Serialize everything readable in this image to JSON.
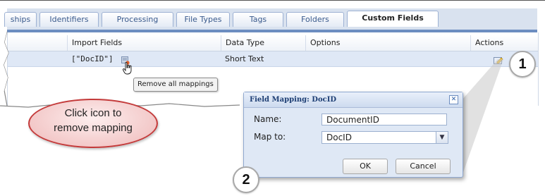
{
  "tabs": [
    {
      "label": "ships"
    },
    {
      "label": "Identifiers"
    },
    {
      "label": "Processing"
    },
    {
      "label": "File Types"
    },
    {
      "label": "Tags"
    },
    {
      "label": "Folders"
    },
    {
      "label": "Custom Fields",
      "active": true
    }
  ],
  "grid": {
    "headers": [
      "Import Fields",
      "Data Type",
      "Options",
      "Actions"
    ],
    "rows": [
      {
        "import_fields": "[\"DocID\"]",
        "data_type": "Short Text",
        "options": ""
      }
    ]
  },
  "tooltip": "Remove all mappings",
  "callout": {
    "line1": "Click icon to",
    "line2": "remove mapping"
  },
  "dialog": {
    "title": "Field Mapping: DocID",
    "name_label": "Name:",
    "name_value": "DocumentID",
    "map_label": "Map to:",
    "map_value": "DocID",
    "ok": "OK",
    "cancel": "Cancel"
  },
  "badges": [
    "1",
    "2"
  ],
  "icons": {
    "remove_mapping": "remove-mapping-icon",
    "edit": "edit-icon",
    "close": "close-icon",
    "dropdown": "chevron-down-icon",
    "cursor": "hand-cursor-icon"
  },
  "colors": {
    "accent": "#6c8dc0",
    "callout_border": "#c43a3a",
    "row_highlight": "#dfe8f6"
  }
}
